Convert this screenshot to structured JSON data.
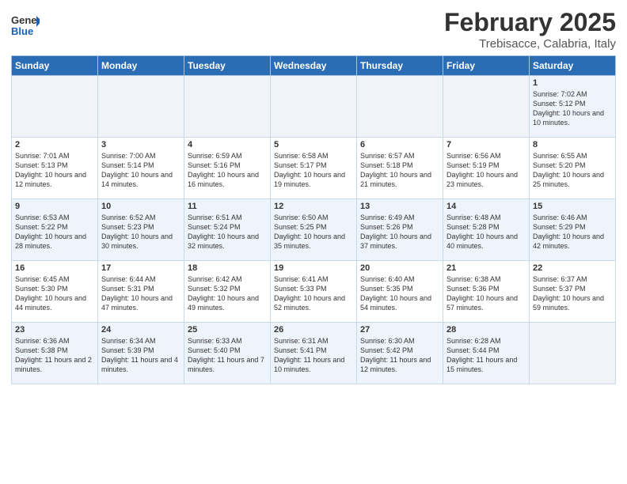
{
  "header": {
    "logo_general": "General",
    "logo_blue": "Blue",
    "month_title": "February 2025",
    "location": "Trebisacce, Calabria, Italy"
  },
  "days_of_week": [
    "Sunday",
    "Monday",
    "Tuesday",
    "Wednesday",
    "Thursday",
    "Friday",
    "Saturday"
  ],
  "weeks": [
    [
      {
        "day": "",
        "info": ""
      },
      {
        "day": "",
        "info": ""
      },
      {
        "day": "",
        "info": ""
      },
      {
        "day": "",
        "info": ""
      },
      {
        "day": "",
        "info": ""
      },
      {
        "day": "",
        "info": ""
      },
      {
        "day": "1",
        "info": "Sunrise: 7:02 AM\nSunset: 5:12 PM\nDaylight: 10 hours\nand 10 minutes."
      }
    ],
    [
      {
        "day": "2",
        "info": "Sunrise: 7:01 AM\nSunset: 5:13 PM\nDaylight: 10 hours\nand 12 minutes."
      },
      {
        "day": "3",
        "info": "Sunrise: 7:00 AM\nSunset: 5:14 PM\nDaylight: 10 hours\nand 14 minutes."
      },
      {
        "day": "4",
        "info": "Sunrise: 6:59 AM\nSunset: 5:16 PM\nDaylight: 10 hours\nand 16 minutes."
      },
      {
        "day": "5",
        "info": "Sunrise: 6:58 AM\nSunset: 5:17 PM\nDaylight: 10 hours\nand 19 minutes."
      },
      {
        "day": "6",
        "info": "Sunrise: 6:57 AM\nSunset: 5:18 PM\nDaylight: 10 hours\nand 21 minutes."
      },
      {
        "day": "7",
        "info": "Sunrise: 6:56 AM\nSunset: 5:19 PM\nDaylight: 10 hours\nand 23 minutes."
      },
      {
        "day": "8",
        "info": "Sunrise: 6:55 AM\nSunset: 5:20 PM\nDaylight: 10 hours\nand 25 minutes."
      }
    ],
    [
      {
        "day": "9",
        "info": "Sunrise: 6:53 AM\nSunset: 5:22 PM\nDaylight: 10 hours\nand 28 minutes."
      },
      {
        "day": "10",
        "info": "Sunrise: 6:52 AM\nSunset: 5:23 PM\nDaylight: 10 hours\nand 30 minutes."
      },
      {
        "day": "11",
        "info": "Sunrise: 6:51 AM\nSunset: 5:24 PM\nDaylight: 10 hours\nand 32 minutes."
      },
      {
        "day": "12",
        "info": "Sunrise: 6:50 AM\nSunset: 5:25 PM\nDaylight: 10 hours\nand 35 minutes."
      },
      {
        "day": "13",
        "info": "Sunrise: 6:49 AM\nSunset: 5:26 PM\nDaylight: 10 hours\nand 37 minutes."
      },
      {
        "day": "14",
        "info": "Sunrise: 6:48 AM\nSunset: 5:28 PM\nDaylight: 10 hours\nand 40 minutes."
      },
      {
        "day": "15",
        "info": "Sunrise: 6:46 AM\nSunset: 5:29 PM\nDaylight: 10 hours\nand 42 minutes."
      }
    ],
    [
      {
        "day": "16",
        "info": "Sunrise: 6:45 AM\nSunset: 5:30 PM\nDaylight: 10 hours\nand 44 minutes."
      },
      {
        "day": "17",
        "info": "Sunrise: 6:44 AM\nSunset: 5:31 PM\nDaylight: 10 hours\nand 47 minutes."
      },
      {
        "day": "18",
        "info": "Sunrise: 6:42 AM\nSunset: 5:32 PM\nDaylight: 10 hours\nand 49 minutes."
      },
      {
        "day": "19",
        "info": "Sunrise: 6:41 AM\nSunset: 5:33 PM\nDaylight: 10 hours\nand 52 minutes."
      },
      {
        "day": "20",
        "info": "Sunrise: 6:40 AM\nSunset: 5:35 PM\nDaylight: 10 hours\nand 54 minutes."
      },
      {
        "day": "21",
        "info": "Sunrise: 6:38 AM\nSunset: 5:36 PM\nDaylight: 10 hours\nand 57 minutes."
      },
      {
        "day": "22",
        "info": "Sunrise: 6:37 AM\nSunset: 5:37 PM\nDaylight: 10 hours\nand 59 minutes."
      }
    ],
    [
      {
        "day": "23",
        "info": "Sunrise: 6:36 AM\nSunset: 5:38 PM\nDaylight: 11 hours\nand 2 minutes."
      },
      {
        "day": "24",
        "info": "Sunrise: 6:34 AM\nSunset: 5:39 PM\nDaylight: 11 hours\nand 4 minutes."
      },
      {
        "day": "25",
        "info": "Sunrise: 6:33 AM\nSunset: 5:40 PM\nDaylight: 11 hours\nand 7 minutes."
      },
      {
        "day": "26",
        "info": "Sunrise: 6:31 AM\nSunset: 5:41 PM\nDaylight: 11 hours\nand 10 minutes."
      },
      {
        "day": "27",
        "info": "Sunrise: 6:30 AM\nSunset: 5:42 PM\nDaylight: 11 hours\nand 12 minutes."
      },
      {
        "day": "28",
        "info": "Sunrise: 6:28 AM\nSunset: 5:44 PM\nDaylight: 11 hours\nand 15 minutes."
      },
      {
        "day": "",
        "info": ""
      }
    ]
  ]
}
